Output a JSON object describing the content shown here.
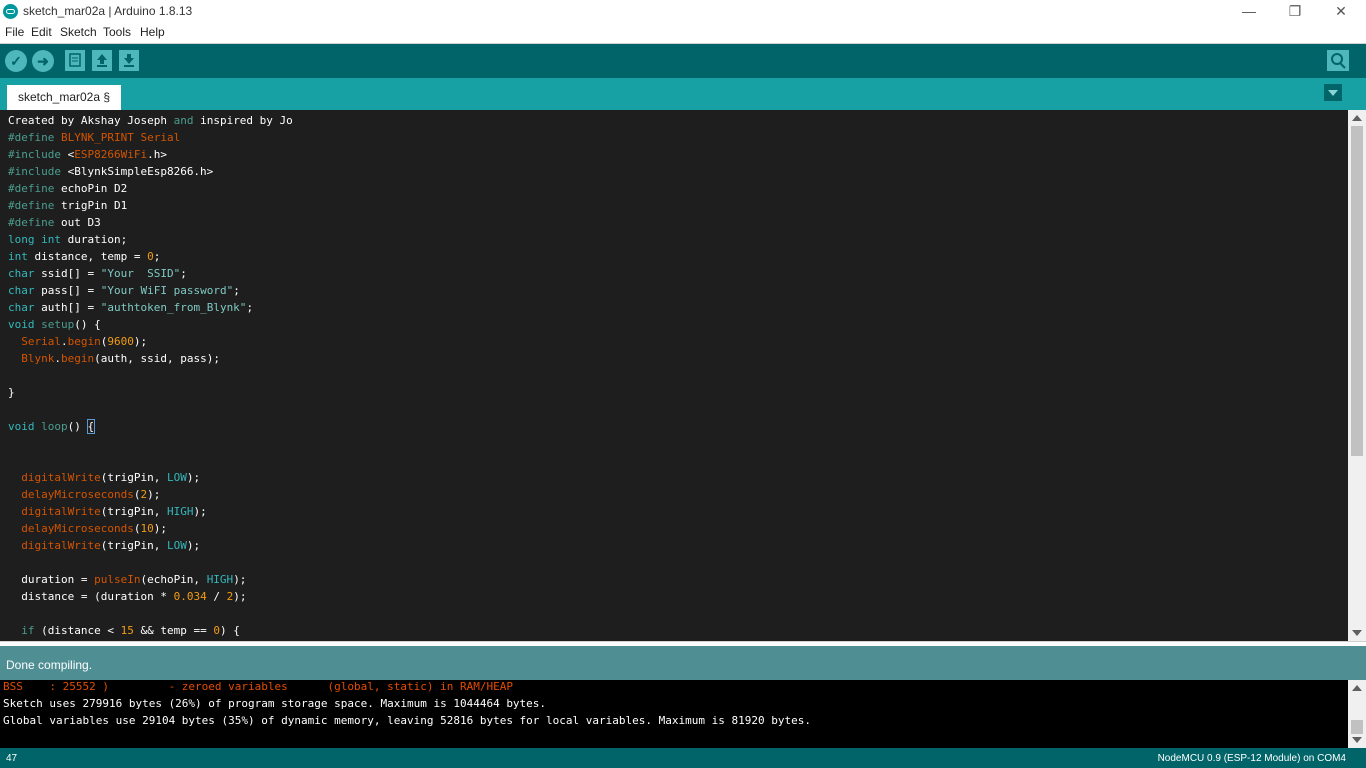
{
  "window": {
    "title": "sketch_mar02a | Arduino 1.8.13",
    "minimize": "—",
    "maximize": "❐",
    "close": "✕"
  },
  "menu": [
    "File",
    "Edit",
    "Sketch",
    "Tools",
    "Help"
  ],
  "toolbar": {
    "verify_icon": "check-icon",
    "upload_icon": "arrow-right-icon",
    "new_icon": "new-file-icon",
    "open_icon": "arrow-up-icon",
    "save_icon": "arrow-down-icon",
    "serial_monitor_icon": "magnifier-icon"
  },
  "tab": {
    "label": "sketch_mar02a §"
  },
  "code": [
    [
      [
        "Created by Akshay Joseph ",
        ""
      ],
      [
        "and",
        "pp"
      ],
      [
        " inspired by Jo",
        ""
      ]
    ],
    [
      [
        "#define",
        "pp"
      ],
      [
        " ",
        ""
      ],
      [
        "BLYNK_PRINT Serial",
        "fn"
      ]
    ],
    [
      [
        "#include",
        "pp"
      ],
      [
        " <",
        ""
      ],
      [
        "ESP8266WiFi",
        "fn"
      ],
      [
        ".h>",
        ""
      ]
    ],
    [
      [
        "#include",
        "pp"
      ],
      [
        " <BlynkSimpleEsp8266.h>",
        ""
      ]
    ],
    [
      [
        "#define",
        "pp"
      ],
      [
        " echoPin D2",
        ""
      ]
    ],
    [
      [
        "#define",
        "pp"
      ],
      [
        " trigPin D1",
        ""
      ]
    ],
    [
      [
        "#define",
        "pp"
      ],
      [
        " out D3",
        ""
      ]
    ],
    [
      [
        "long",
        "kw"
      ],
      [
        " ",
        ""
      ],
      [
        "int",
        "kw"
      ],
      [
        " duration;",
        ""
      ]
    ],
    [
      [
        "int",
        "kw"
      ],
      [
        " distance, temp = ",
        ""
      ],
      [
        "0",
        "nm"
      ],
      [
        ";",
        ""
      ]
    ],
    [
      [
        "char",
        "kw"
      ],
      [
        " ssid[] = ",
        ""
      ],
      [
        "\"Your  SSID\"",
        "st"
      ],
      [
        ";",
        ""
      ]
    ],
    [
      [
        "char",
        "kw"
      ],
      [
        " pass[] = ",
        ""
      ],
      [
        "\"Your WiFI password\"",
        "st"
      ],
      [
        ";",
        ""
      ]
    ],
    [
      [
        "char",
        "kw"
      ],
      [
        " auth[] = ",
        ""
      ],
      [
        "\"authtoken_from_Blynk\"",
        "st"
      ],
      [
        ";",
        ""
      ]
    ],
    [
      [
        "void",
        "kw"
      ],
      [
        " ",
        ""
      ],
      [
        "setup",
        "pp"
      ],
      [
        "() {",
        ""
      ]
    ],
    [
      [
        "  ",
        ""
      ],
      [
        "Serial",
        "fn"
      ],
      [
        ".",
        ""
      ],
      [
        "begin",
        "fn"
      ],
      [
        "(",
        ""
      ],
      [
        "9600",
        "nm"
      ],
      [
        ");",
        ""
      ]
    ],
    [
      [
        "  ",
        ""
      ],
      [
        "Blynk",
        "fn"
      ],
      [
        ".",
        ""
      ],
      [
        "begin",
        "fn"
      ],
      [
        "(auth, ssid, pass);",
        ""
      ]
    ],
    [],
    [
      [
        "}",
        ""
      ]
    ],
    [],
    [
      [
        "void",
        "kw"
      ],
      [
        " ",
        ""
      ],
      [
        "loop",
        "pp"
      ],
      [
        "() ",
        ""
      ],
      [
        "{",
        "bracket"
      ]
    ],
    [],
    [],
    [
      [
        "  ",
        ""
      ],
      [
        "digitalWrite",
        "fn"
      ],
      [
        "(trigPin, ",
        ""
      ],
      [
        "LOW",
        "kw"
      ],
      [
        ");",
        ""
      ]
    ],
    [
      [
        "  ",
        ""
      ],
      [
        "delayMicroseconds",
        "fn"
      ],
      [
        "(",
        ""
      ],
      [
        "2",
        "nm"
      ],
      [
        ");",
        ""
      ]
    ],
    [
      [
        "  ",
        ""
      ],
      [
        "digitalWrite",
        "fn"
      ],
      [
        "(trigPin, ",
        ""
      ],
      [
        "HIGH",
        "kw"
      ],
      [
        ");",
        ""
      ]
    ],
    [
      [
        "  ",
        ""
      ],
      [
        "delayMicroseconds",
        "fn"
      ],
      [
        "(",
        ""
      ],
      [
        "10",
        "nm"
      ],
      [
        ");",
        ""
      ]
    ],
    [
      [
        "  ",
        ""
      ],
      [
        "digitalWrite",
        "fn"
      ],
      [
        "(trigPin, ",
        ""
      ],
      [
        "LOW",
        "kw"
      ],
      [
        ");",
        ""
      ]
    ],
    [],
    [
      [
        "  duration = ",
        ""
      ],
      [
        "pulseIn",
        "fn"
      ],
      [
        "(echoPin, ",
        ""
      ],
      [
        "HIGH",
        "kw"
      ],
      [
        ");",
        ""
      ]
    ],
    [
      [
        "  distance = (duration * ",
        ""
      ],
      [
        "0.034",
        "nm"
      ],
      [
        " / ",
        ""
      ],
      [
        "2",
        "nm"
      ],
      [
        ");",
        ""
      ]
    ],
    [],
    [
      [
        "  ",
        ""
      ],
      [
        "if",
        "pp"
      ],
      [
        " (distance < ",
        ""
      ],
      [
        "15",
        "nm"
      ],
      [
        " && temp == ",
        ""
      ],
      [
        "0",
        "nm"
      ],
      [
        ") {",
        ""
      ]
    ]
  ],
  "status": {
    "message": "Done compiling."
  },
  "console": [
    {
      "text": "BSS    : 25552 )         - zeroed variables      (global, static) in RAM/HEAP",
      "kind": "err"
    },
    {
      "text": "Sketch uses 279916 bytes (26%) of program storage space. Maximum is 1044464 bytes.",
      "kind": "out"
    },
    {
      "text": "Global variables use 29104 bytes (35%) of dynamic memory, leaving 52816 bytes for local variables. Maximum is 81920 bytes.",
      "kind": "out"
    }
  ],
  "footer": {
    "line": "47",
    "board": "NodeMCU 0.9 (ESP-12 Module) on COM4"
  }
}
